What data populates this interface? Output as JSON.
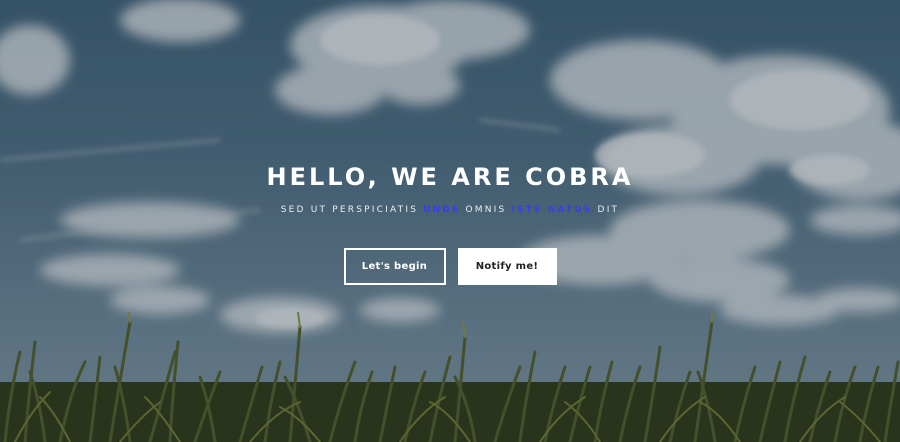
{
  "hero": {
    "title": "HELLO, WE ARE COBRA",
    "subtitle": {
      "part1": "SED UT PERSPICIATIS ",
      "highlight1": "UNDE",
      "part2": " OMNIS ",
      "highlight2": "ISTE NATUS",
      "part3": " DIT"
    },
    "buttons": {
      "primary": "Let's begin",
      "secondary": "Notify me!"
    }
  },
  "colors": {
    "highlight": "#3a3cf0",
    "text": "#ffffff"
  }
}
